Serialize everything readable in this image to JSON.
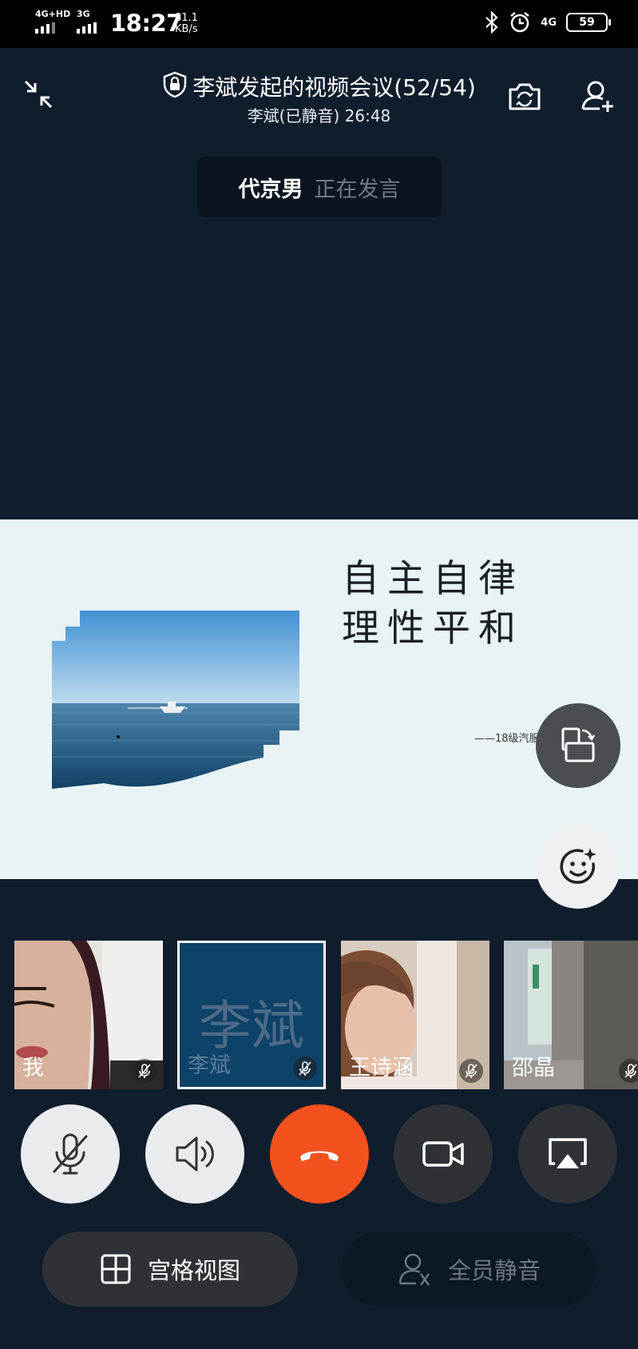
{
  "status_bar": {
    "net1": "4G+HD",
    "net2": "3G",
    "time": "18:27",
    "speed_value": "81.1",
    "speed_unit": "KB/s",
    "net3": "4G",
    "battery": "59"
  },
  "header": {
    "title": "李斌发起的视频会议(52/54)",
    "subtitle": "李斌(已静音) 26:48"
  },
  "speaker": {
    "name": "代京男",
    "status": "正在发言"
  },
  "slide": {
    "line1": "自主自律",
    "line2": "理性平和",
    "credit": "——18级汽服二班"
  },
  "participants": [
    {
      "label": "我"
    },
    {
      "label": "李斌",
      "avatar_text": "李斌"
    },
    {
      "label": "王诗涵"
    },
    {
      "label": "邵晶"
    }
  ],
  "controls": {
    "grid_view": "宫格视图",
    "mute_all": "全员静音"
  },
  "colors": {
    "background": "#0f1d2c",
    "hangup": "#f4511e",
    "selected_tile": "#0d4269"
  }
}
